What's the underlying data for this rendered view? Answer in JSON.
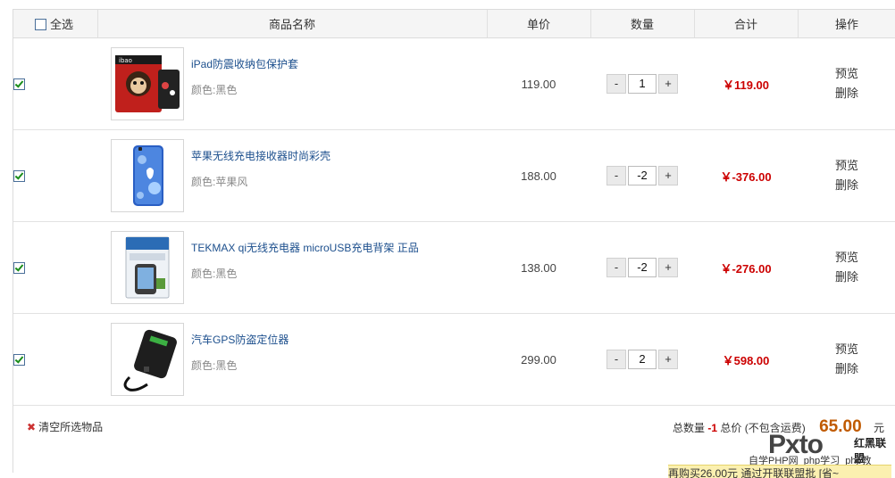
{
  "header": {
    "select_all": "全选",
    "name": "商品名称",
    "price": "单价",
    "qty": "数量",
    "subtotal": "合计",
    "ops": "操作"
  },
  "items": [
    {
      "name": "iPad防震收纳包保护套",
      "attr": "颜色:黑色",
      "price": "119.00",
      "qty": "1",
      "subtotal": "￥119.00",
      "checked": true
    },
    {
      "name": "苹果无线充电接收器时尚彩壳",
      "attr": "颜色:苹果风",
      "price": "188.00",
      "qty": "-2",
      "subtotal": "￥-376.00",
      "checked": true
    },
    {
      "name": "TEKMAX qi无线充电器 microUSB充电背架 正品",
      "attr": "颜色:黑色",
      "price": "138.00",
      "qty": "-2",
      "subtotal": "￥-276.00",
      "checked": true
    },
    {
      "name": "汽车GPS防盗定位器",
      "attr": "颜色:黑色",
      "price": "299.00",
      "qty": "2",
      "subtotal": "￥598.00",
      "checked": true
    }
  ],
  "ops": {
    "preview": "预览",
    "delete": "删除"
  },
  "qty_controls": {
    "minus": "-",
    "plus": "+"
  },
  "footer": {
    "clear": "清空所选物品",
    "total_qty_label": "总数量",
    "total_qty": "-1",
    "total_price_label": "总价 (不包含运费)",
    "total_price": "65.00",
    "currency": "元"
  },
  "watermark": {
    "logo": "Pxto",
    "brand": "红黑联盟",
    "line": "自学PHP网_php学习_php教",
    "strip": "再购买26.00元 通过开联联盟批 [省~"
  },
  "colors": {
    "link": "#1c4f8d",
    "price_red": "#cc0000",
    "total_orange": "#c05a00"
  }
}
